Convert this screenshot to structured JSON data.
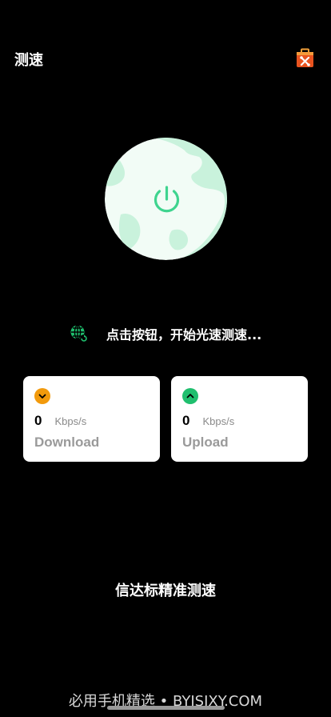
{
  "header": {
    "title": "测速",
    "toolbox_icon": "toolbox-icon"
  },
  "power": {
    "icon": "power-icon",
    "accent": "#3fd48f",
    "globe_light": "#f2fcf6",
    "globe_land": "#c9f2dc"
  },
  "status": {
    "icon": "globe-refresh-icon",
    "text": "点击按钮，开始光速测速..."
  },
  "cards": {
    "download": {
      "icon": "chevron-down-icon",
      "icon_color": "#f29a0c",
      "value": "0",
      "unit": "Kbps/s",
      "label": "Download"
    },
    "upload": {
      "icon": "chevron-up-icon",
      "icon_color": "#1fbf6e",
      "value": "0",
      "unit": "Kbps/s",
      "label": "Upload"
    }
  },
  "brand": {
    "name": "信达标精准测速"
  },
  "watermark": {
    "text": "必用手机精选 • BYJSJXY.COM"
  }
}
